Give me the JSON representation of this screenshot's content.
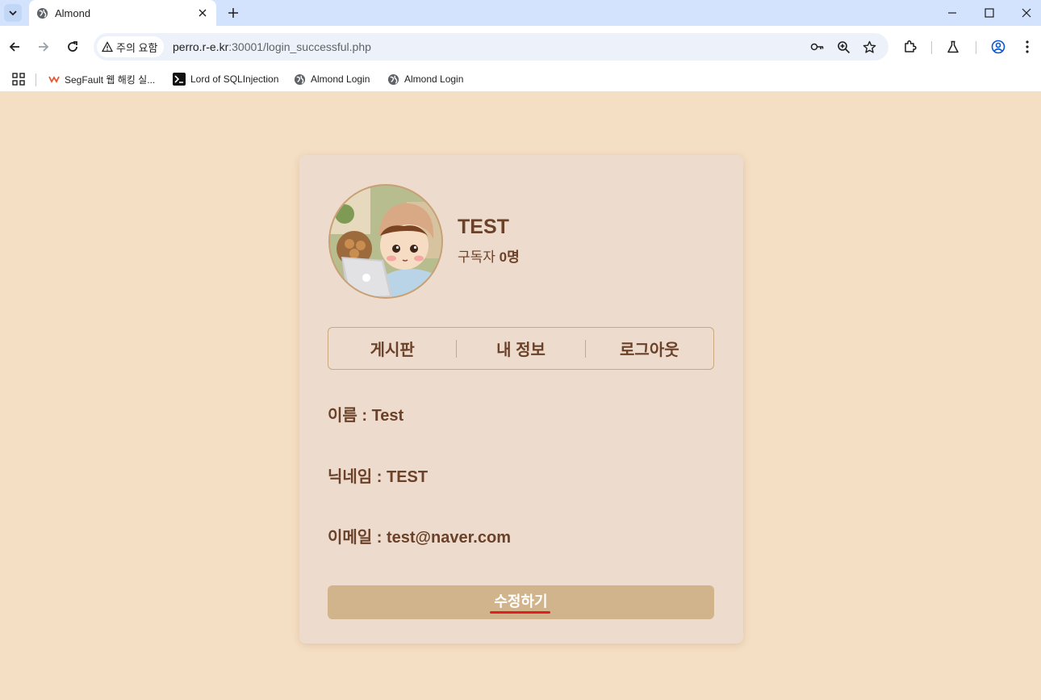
{
  "browser": {
    "tab_title": "Almond",
    "security_label": "주의 요함",
    "url_host": "perro.r-e.kr",
    "url_rest": ":30001/login_successful.php",
    "bookmarks": [
      {
        "label": "SegFault 웹 해킹 실...",
        "icon": "segfault-icon"
      },
      {
        "label": "Lord of SQLInjection",
        "icon": "terminal-icon"
      },
      {
        "label": "Almond Login",
        "icon": "globe-icon"
      },
      {
        "label": "Almond Login",
        "icon": "globe-icon"
      }
    ]
  },
  "profile": {
    "username": "TEST",
    "subscribers_label": "구독자",
    "subscribers_count": "0명"
  },
  "menu": {
    "board": "게시판",
    "my_info": "내 정보",
    "logout": "로그아웃"
  },
  "info": {
    "name": "이름 : Test",
    "nickname": "닉네임 : TEST",
    "email": "이메일 : test@naver.com"
  },
  "actions": {
    "edit_label": "수정하기"
  },
  "colors": {
    "page_bg": "#f5dfc4",
    "card_bg": "#eddccd",
    "text_brown": "#6b4129",
    "button_bg": "#d2b48c",
    "highlight_red": "#e02020"
  }
}
